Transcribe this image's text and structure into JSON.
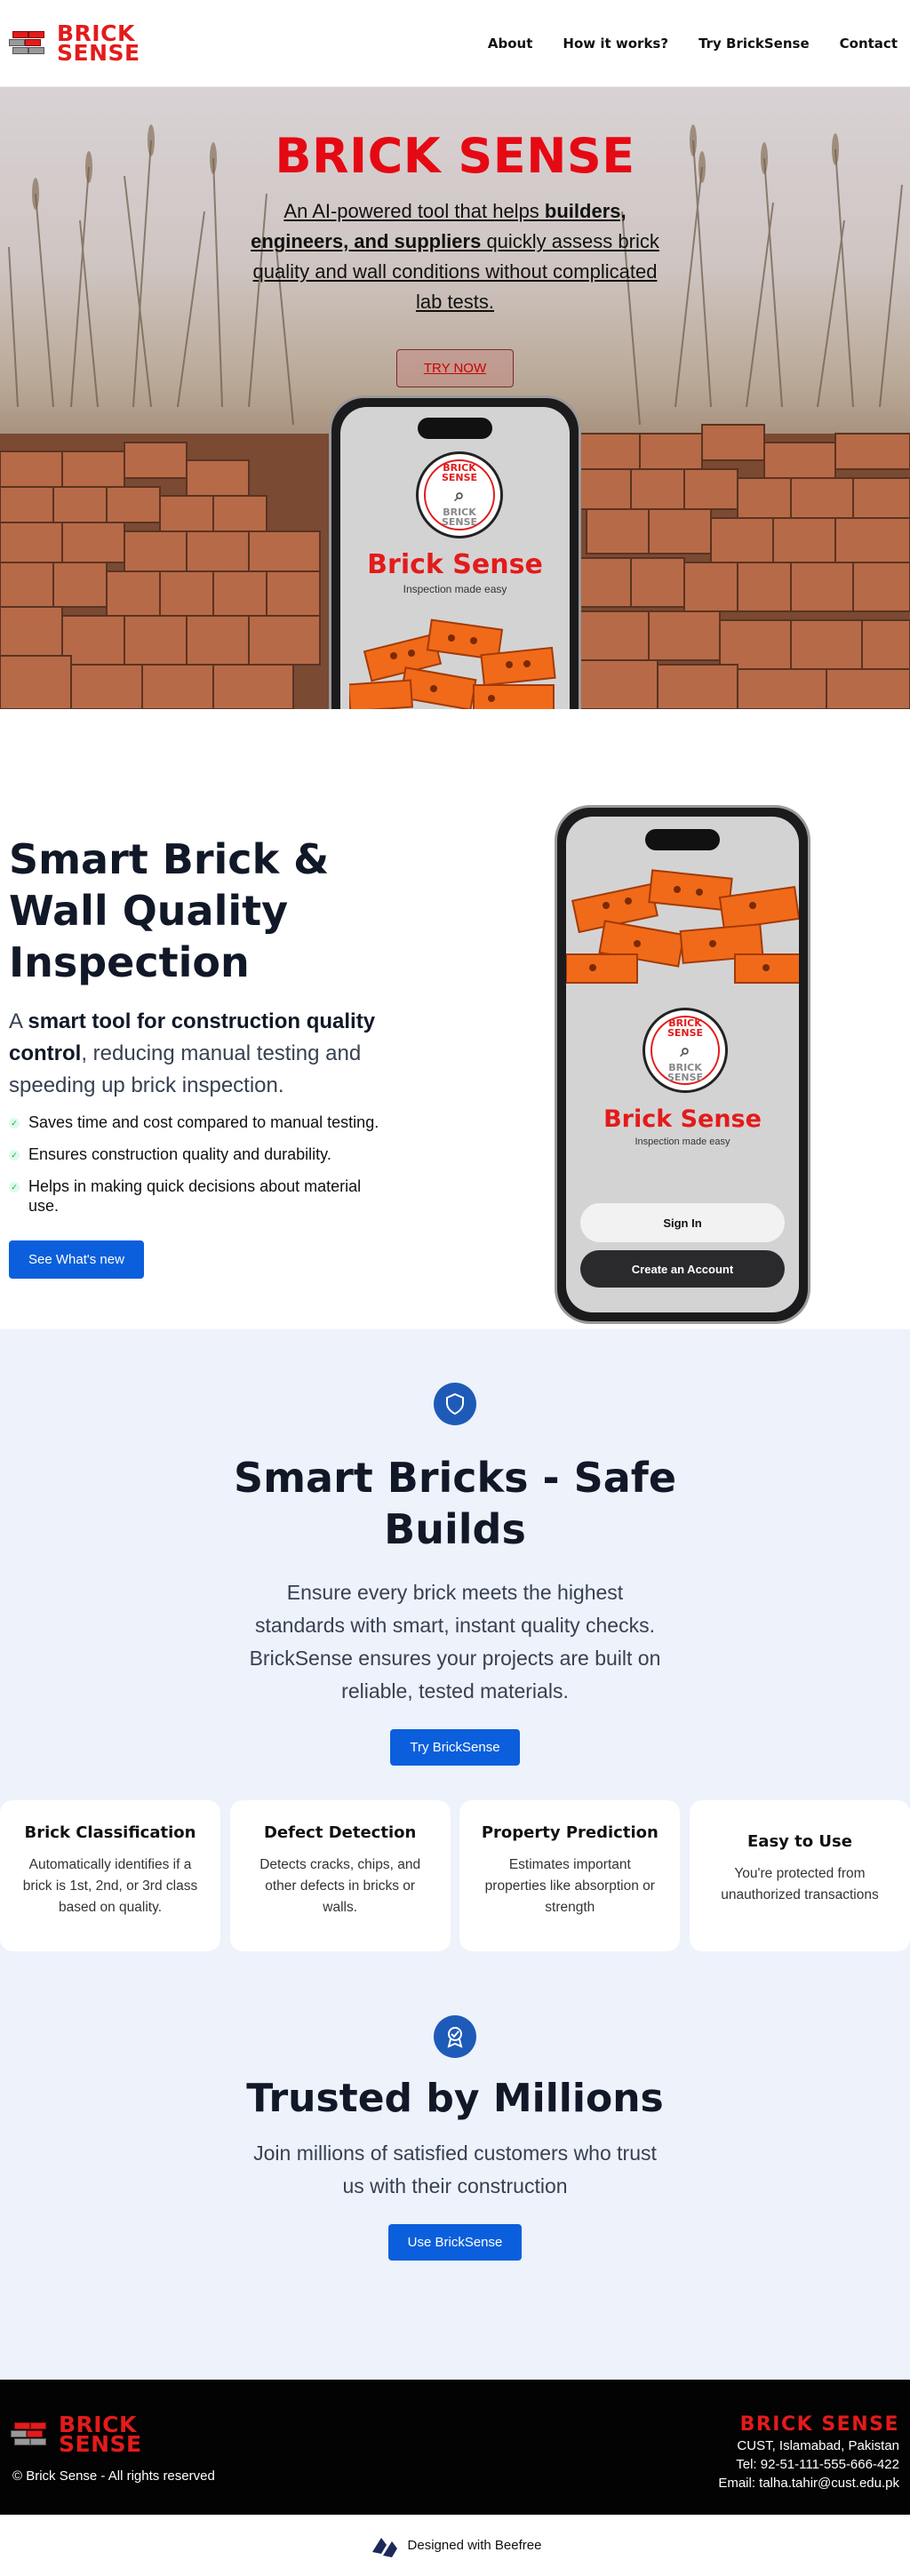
{
  "nav": {
    "logo_line1": "BRICK",
    "logo_line2": "SENSE",
    "links": [
      "About",
      "How it works?",
      "Try BrickSense",
      "Contact"
    ]
  },
  "hero": {
    "title": "BRICK SENSE",
    "subtitle_pre": "An AI-powered tool that helps ",
    "subtitle_bold": "builders, engineers, and suppliers",
    "subtitle_post": " quickly assess brick quality and wall conditions without complicated lab tests.",
    "cta": "TRY NOW"
  },
  "app": {
    "seal_top": "BRICK SENSE",
    "seal_bottom": "BRICK SENSE",
    "name": "Brick Sense",
    "tagline": "Inspection made easy",
    "sign_in": "Sign In",
    "create_account": "Create an Account"
  },
  "feature": {
    "title": "Smart Brick & Wall Quality Inspection",
    "desc_pre": "A ",
    "desc_bold": "smart tool for construction quality control",
    "desc_post": ", reducing manual testing and speeding up brick inspection.",
    "bullets": [
      "Saves time and cost compared to manual testing.",
      "Ensures construction quality and durability.",
      "Helps in making quick decisions about material use."
    ],
    "cta": "See What's new"
  },
  "safe": {
    "title": "Smart Bricks - Safe Builds",
    "desc": "Ensure every brick meets the highest standards with smart, instant quality checks. BrickSense ensures your projects are built on reliable, tested materials.",
    "cta": "Try BrickSense"
  },
  "cards": [
    {
      "title": "Brick Classification",
      "text": "Automatically identifies if a brick is 1st, 2nd, or 3rd class based on quality."
    },
    {
      "title": "Defect Detection",
      "text": "Detects cracks, chips, and other defects in bricks or walls."
    },
    {
      "title": "Property Prediction",
      "text": "Estimates important properties like absorption or strength"
    },
    {
      "title": "Easy to Use",
      "text": "You're protected from unauthorized transactions"
    }
  ],
  "trust": {
    "title": "Trusted by Millions",
    "desc": "Join millions of satisfied customers who trust us with their construction",
    "cta": "Use BrickSense"
  },
  "footer": {
    "copyright": "© Brick Sense - All rights reserved",
    "brand": "BRICK SENSE",
    "address": "CUST, Islamabad, Pakistan",
    "tel": "Tel: 92-51-111-555-666-422",
    "email": "Email: talha.tahir@cust.edu.pk",
    "designed": "Designed with Beefree"
  },
  "colors": {
    "brand_red": "#e31b1b",
    "accent_blue": "#0b5fdc",
    "section_bg": "#edf2fb"
  }
}
